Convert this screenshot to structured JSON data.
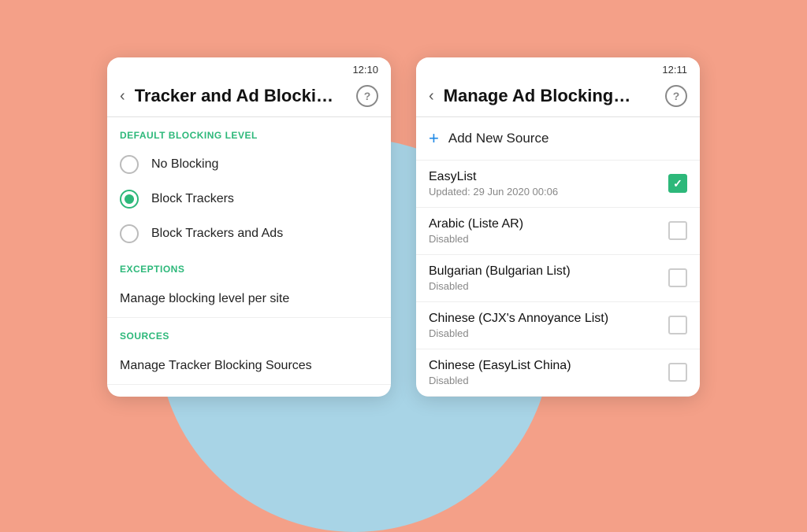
{
  "background": {
    "color": "#F4A088",
    "shapeColor": "#A8D4E6"
  },
  "leftPanel": {
    "statusBar": {
      "time": "12:10"
    },
    "header": {
      "title": "Tracker and Ad Blocki…",
      "backLabel": "‹",
      "helpLabel": "?"
    },
    "sections": {
      "defaultBlockingLevel": {
        "label": "DEFAULT BLOCKING LEVEL",
        "options": [
          {
            "label": "No Blocking",
            "selected": false
          },
          {
            "label": "Block Trackers",
            "selected": true
          },
          {
            "label": "Block Trackers and Ads",
            "selected": false
          }
        ]
      },
      "exceptions": {
        "label": "EXCEPTIONS",
        "items": [
          {
            "label": "Manage blocking level per site"
          }
        ]
      },
      "sources": {
        "label": "SOURCES",
        "items": [
          {
            "label": "Manage Tracker Blocking Sources"
          }
        ]
      }
    }
  },
  "rightPanel": {
    "statusBar": {
      "time": "12:11"
    },
    "header": {
      "title": "Manage Ad Blocking…",
      "backLabel": "‹",
      "helpLabel": "?"
    },
    "addSource": {
      "icon": "+",
      "label": "Add New Source"
    },
    "sources": [
      {
        "name": "EasyList",
        "sub": "Updated: 29 Jun 2020 00:06",
        "checked": true
      },
      {
        "name": "Arabic (Liste AR)",
        "sub": "Disabled",
        "checked": false
      },
      {
        "name": "Bulgarian (Bulgarian List)",
        "sub": "Disabled",
        "checked": false
      },
      {
        "name": "Chinese (CJX's Annoyance List)",
        "sub": "Disabled",
        "checked": false
      },
      {
        "name": "Chinese (EasyList China)",
        "sub": "Disabled",
        "checked": false
      }
    ]
  }
}
